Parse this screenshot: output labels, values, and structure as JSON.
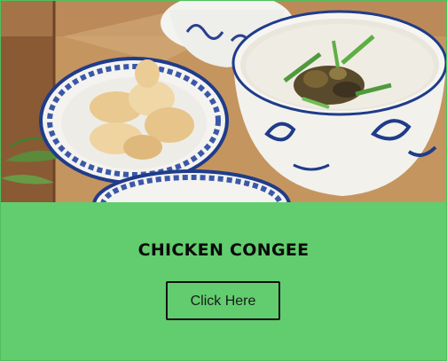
{
  "card": {
    "title": "CHICKEN CONGEE",
    "button_label": "Click Here",
    "image_alt": "chicken-congee-photo"
  },
  "colors": {
    "card_background": "#62cd6e",
    "card_border": "#4fbf5c",
    "title_text": "#0a0a0a",
    "button_border": "#111111"
  }
}
